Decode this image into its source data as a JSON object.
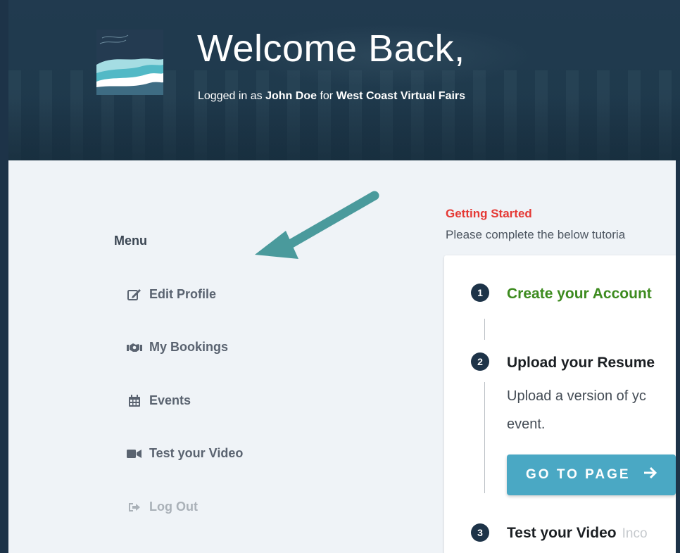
{
  "header": {
    "welcome": "Welcome Back,",
    "logged_prefix": "Logged in as",
    "user_name": "John Doe",
    "logged_mid": "for",
    "org_name": "West Coast Virtual Fairs"
  },
  "menu": {
    "title": "Menu",
    "items": [
      {
        "label": "Edit Profile",
        "icon": "edit-icon"
      },
      {
        "label": "My Bookings",
        "icon": "handshake-icon"
      },
      {
        "label": "Events",
        "icon": "calendar-icon"
      },
      {
        "label": "Test your Video",
        "icon": "video-camera-icon"
      },
      {
        "label": "Log Out",
        "icon": "sign-out-icon"
      }
    ]
  },
  "getting_started": {
    "title": "Getting Started",
    "subtitle": "Please complete the below tutoria",
    "steps": [
      {
        "number": "1",
        "title": "Create your Account",
        "status": "complete"
      },
      {
        "number": "2",
        "title": "Upload your Resume",
        "desc_line1": "Upload a version of yc",
        "desc_line2": "event.",
        "button": "GO TO PAGE"
      },
      {
        "number": "3",
        "title": "Test your Video",
        "status_text": "Inco"
      }
    ]
  },
  "colors": {
    "navy": "#1d3348",
    "accent_teal": "#4aa8c4",
    "arrow_teal": "#4a9a9c",
    "complete_green": "#3d8b1f",
    "getting_started_red": "#e53935"
  }
}
